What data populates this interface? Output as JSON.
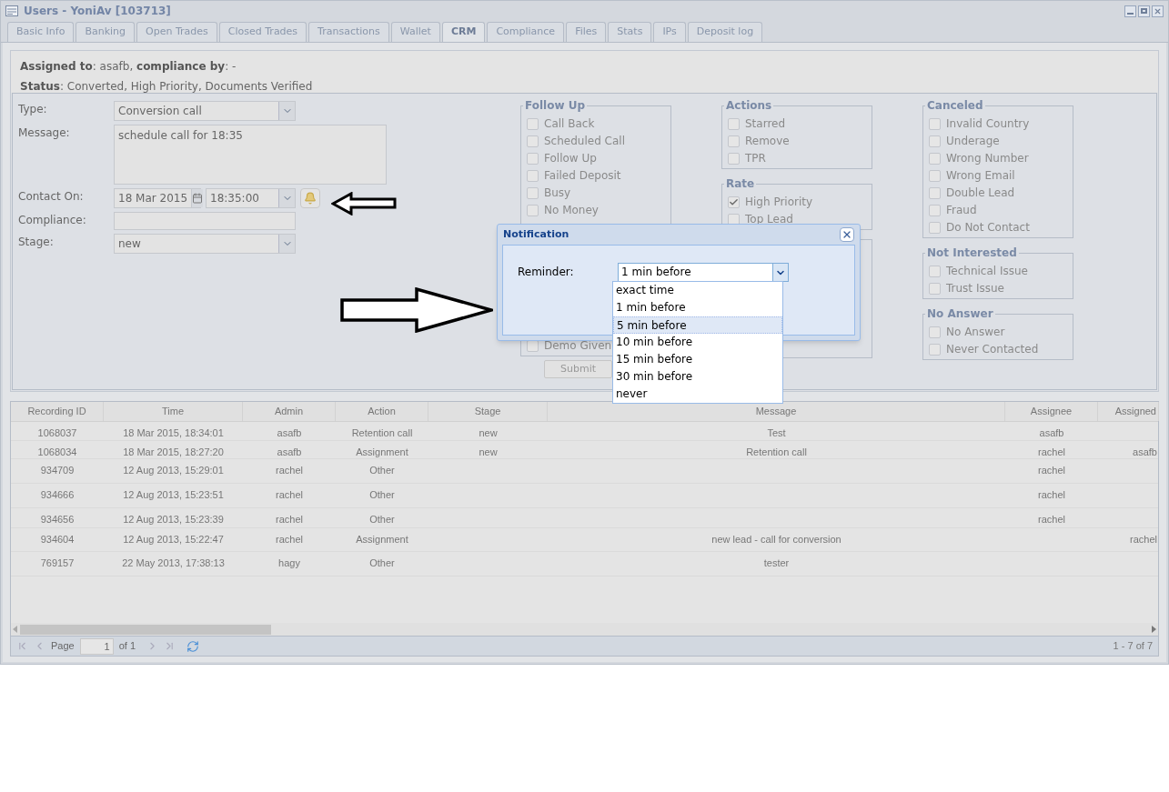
{
  "window": {
    "title": "Users - YoniAv [103713]"
  },
  "tabs": [
    {
      "label": "Basic Info",
      "selected": false
    },
    {
      "label": "Banking",
      "selected": false
    },
    {
      "label": "Open Trades",
      "selected": false
    },
    {
      "label": "Closed Trades",
      "selected": false
    },
    {
      "label": "Transactions",
      "selected": false
    },
    {
      "label": "Wallet",
      "selected": false
    },
    {
      "label": "CRM",
      "selected": true
    },
    {
      "label": "Compliance",
      "selected": false
    },
    {
      "label": "Files",
      "selected": false
    },
    {
      "label": "Stats",
      "selected": false
    },
    {
      "label": "IPs",
      "selected": false
    },
    {
      "label": "Deposit log",
      "selected": false
    }
  ],
  "summary": [
    "**Assigned to**: asafb, **compliance by**: -",
    "**Status**: Converted, High Priority, Documents Verified"
  ],
  "form": [
    {
      "kind": "combo",
      "label": "Type:",
      "value": "Conversion call"
    },
    {
      "kind": "textarea",
      "label": "Message:",
      "value": "schedule call for 18:35"
    },
    {
      "kind": "datetime",
      "label": "Contact On:",
      "date": "18 Mar 2015",
      "time": "18:35:00"
    },
    {
      "kind": "text",
      "label": "Compliance:"
    },
    {
      "kind": "combo",
      "label": "Stage:",
      "value": "new"
    }
  ],
  "group_columns": [
    [
      {
        "title": "Follow Up",
        "items": [
          {
            "label": "Call Back",
            "checked": false
          },
          {
            "label": "Scheduled Call",
            "checked": false
          },
          {
            "label": "Follow Up",
            "checked": false
          },
          {
            "label": "Failed Deposit",
            "checked": false
          },
          {
            "label": "Busy",
            "checked": false
          },
          {
            "label": "No Money",
            "checked": false
          },
          {
            "label": "Demo Given",
            "checked": false
          }
        ]
      }
    ],
    [
      {
        "title": "Actions",
        "items": [
          {
            "label": "Starred",
            "checked": false
          },
          {
            "label": "Remove",
            "checked": false
          },
          {
            "label": "TPR",
            "checked": false
          }
        ]
      },
      {
        "title": "Rate",
        "items": [
          {
            "label": "High Priority",
            "checked": true
          },
          {
            "label": "Top Lead",
            "checked": false
          }
        ]
      },
      {}
    ],
    [
      {
        "title": "Canceled",
        "items": [
          {
            "label": "Invalid Country",
            "checked": false
          },
          {
            "label": "Underage",
            "checked": false
          },
          {
            "label": "Wrong Number",
            "checked": false
          },
          {
            "label": "Wrong Email",
            "checked": false
          },
          {
            "label": "Double Lead",
            "checked": false
          },
          {
            "label": "Fraud",
            "checked": false
          },
          {
            "label": "Do Not Contact",
            "checked": false
          }
        ]
      },
      {
        "title": "Not Interested",
        "items": [
          {
            "label": "Technical Issue",
            "checked": false
          },
          {
            "label": "Trust Issue",
            "checked": false
          }
        ]
      },
      {
        "title": "No Answer",
        "items": [
          {
            "label": "No Answer",
            "checked": false
          },
          {
            "label": "Never Contacted",
            "checked": false
          }
        ]
      }
    ]
  ],
  "submit": "Submit",
  "dialog": {
    "title": "Notification",
    "label": "Reminder:",
    "value": "1 min before",
    "options": [
      {
        "label": "exact time",
        "highlighted": false
      },
      {
        "label": "1 min before",
        "highlighted": false
      },
      {
        "label": "5 min before",
        "highlighted": true
      },
      {
        "label": "10 min before",
        "highlighted": false
      },
      {
        "label": "15 min before",
        "highlighted": false
      },
      {
        "label": "30 min before",
        "highlighted": false
      },
      {
        "label": "never",
        "highlighted": false
      }
    ]
  },
  "grid": {
    "columns": [
      "Recording ID",
      "Time",
      "Admin",
      "Action",
      "Stage",
      "Message",
      "Assignee",
      "Assigned"
    ],
    "rows": [
      [
        "1068037",
        "18 Mar 2015, 18:34:01",
        "asafb",
        "Retention call",
        "new",
        "Test",
        "asafb",
        ""
      ],
      [
        "1068034",
        "18 Mar 2015, 18:27:20",
        "asafb",
        "Assignment",
        "new",
        "Retention call",
        "rachel",
        "asafb"
      ],
      [
        "934709",
        "12 Aug 2013, 15:29:01",
        "rachel",
        "Other",
        "",
        "",
        "rachel",
        ""
      ],
      [
        "934666",
        "12 Aug 2013, 15:23:51",
        "rachel",
        "Other",
        "",
        "",
        "rachel",
        ""
      ],
      [
        "934656",
        "12 Aug 2013, 15:23:39",
        "rachel",
        "Other",
        "",
        "",
        "rachel",
        ""
      ],
      [
        "934604",
        "12 Aug 2013, 15:22:47",
        "rachel",
        "Assignment",
        "",
        "new lead - call for conversion",
        "",
        "rachel"
      ],
      [
        "769157",
        "22 May 2013, 17:38:13",
        "hagy",
        "Other",
        "",
        "tester",
        "",
        ""
      ]
    ],
    "pager": {
      "page_label": "Page",
      "page": "1",
      "of": "of 1",
      "summary": "1 - 7 of 7"
    }
  }
}
